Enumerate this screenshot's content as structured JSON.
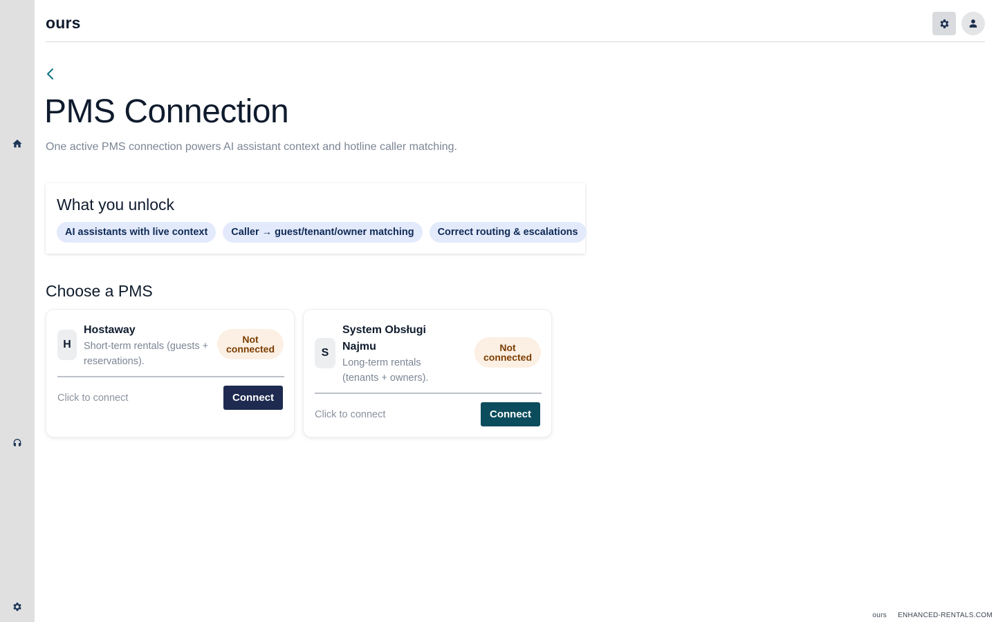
{
  "header": {
    "brand": "ours"
  },
  "page": {
    "title": "PMS Connection",
    "subtitle": "One active PMS connection powers AI assistant context and hotline caller matching."
  },
  "unlock": {
    "title": "What you unlock",
    "chips": [
      "AI assistants with live context",
      "Caller → guest/tenant/owner matching",
      "Correct routing & escalations"
    ]
  },
  "choose": {
    "title": "Choose a PMS",
    "cards": [
      {
        "initial": "H",
        "name": "Hostaway",
        "description": "Short-term rentals (guests + reservations).",
        "status": "Not connected",
        "hint": "Click to connect",
        "button": "Connect"
      },
      {
        "initial": "S",
        "name": "System Obsługi Najmu",
        "description": "Long-term rentals (tenants + owners).",
        "status": "Not connected",
        "hint": "Click to connect",
        "button": "Connect"
      }
    ]
  },
  "footer": {
    "brand": "ours",
    "domain": "ENHANCED-RENTALS.COM"
  },
  "icons": {
    "sidebar": [
      "home-icon",
      "support-icon",
      "gear-icon"
    ],
    "topbar": [
      "gear-icon",
      "user-icon"
    ],
    "back": "chevron-left-icon"
  },
  "colors": {
    "sidebar_bg": "#e0e0e0",
    "chip_bg": "#e3eafb",
    "status_bg": "#fcefe3",
    "status_text": "#7a3d00",
    "connect_primary": "#1e2a4f",
    "connect_secondary": "#0b4d5c",
    "accent": "#0b7285"
  }
}
